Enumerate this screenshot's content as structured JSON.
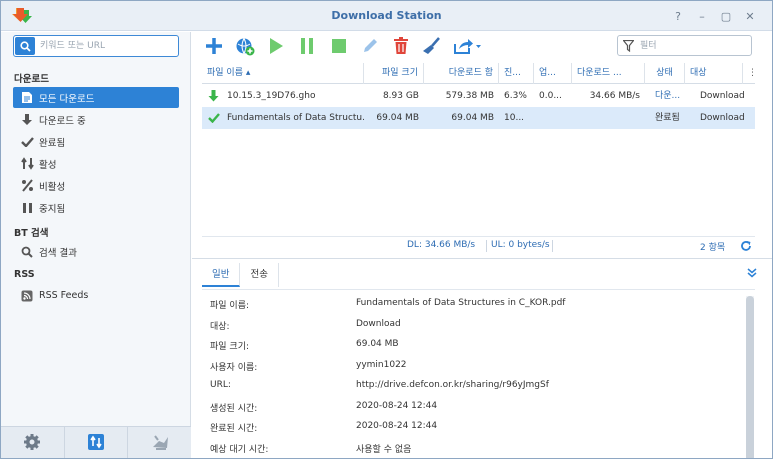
{
  "window": {
    "title": "Download Station",
    "controls": {
      "help": "?",
      "minimize": "–",
      "maximize": "▢",
      "close": "✕"
    }
  },
  "sidebar": {
    "search_placeholder": "키워드 또는 URL",
    "sections": {
      "download": "다운로드",
      "bt_search": "BT 검색",
      "rss": "RSS"
    },
    "items": [
      {
        "label": "모든 다운로드",
        "icon": "all-downloads-icon",
        "active": true
      },
      {
        "label": "다운로드 중",
        "icon": "downloading-icon"
      },
      {
        "label": "완료됨",
        "icon": "check-icon"
      },
      {
        "label": "활성",
        "icon": "active-arrows-icon"
      },
      {
        "label": "비활성",
        "icon": "percent-icon"
      },
      {
        "label": "중지됨",
        "icon": "pause-icon"
      },
      {
        "label": "검색 결과",
        "icon": "search-icon"
      },
      {
        "label": "RSS Feeds",
        "icon": "rss-icon"
      }
    ],
    "bottom_buttons": [
      "settings-icon",
      "transfer-icon",
      "emule-icon"
    ]
  },
  "toolbar": {
    "buttons": [
      "add-icon",
      "add-url-icon",
      "resume-icon",
      "pause-icon",
      "stop-icon",
      "edit-icon",
      "delete-icon",
      "clear-icon",
      "share-icon"
    ],
    "filter_placeholder": "필터"
  },
  "grid": {
    "columns": [
      "파일 이름 ▴",
      "파일 크기",
      "다운로드 함",
      "진...",
      "업...",
      "다운로드 ...",
      "상태",
      "대상",
      "⋮"
    ],
    "rows": [
      {
        "name": "10.15.3_19D76.gho",
        "size": "8.93 GB",
        "downloaded": "579.38 MB",
        "progress": "6.3%",
        "upload": "0.0...",
        "speed": "34.66 MB/s",
        "status": "다운...",
        "dest": "Download",
        "icon": "downloading-arrow-icon"
      },
      {
        "name": "Fundamentals of Data Structu...",
        "size": "69.04 MB",
        "downloaded": "69.04 MB",
        "progress": "10...",
        "upload": "",
        "speed": "",
        "status": "완료됨",
        "dest": "Download",
        "icon": "completed-check-icon"
      }
    ]
  },
  "statusbar": {
    "dl": "DL:  34.66 MB/s",
    "ul": "UL:  0 bytes/s",
    "count": "2 항목"
  },
  "details": {
    "tabs": [
      "일반",
      "전송"
    ],
    "rows": [
      {
        "label": "파일 이름:",
        "value": "Fundamentals of Data Structures in C_KOR.pdf"
      },
      {
        "label": "대상:",
        "value": "Download"
      },
      {
        "label": "파일 크기:",
        "value": "69.04 MB"
      },
      {
        "label": "사용자 이름:",
        "value": "yymin1022"
      },
      {
        "label": "URL:",
        "value": "http://drive.defcon.or.kr/sharing/r96yJmgSf"
      },
      {
        "label": "생성된 시간:",
        "value": "2020-08-24 12:44"
      },
      {
        "label": "완료된 시간:",
        "value": "2020-08-24 12:44"
      },
      {
        "label": "예상 대기 시간:",
        "value": "사용할 수 없음"
      }
    ]
  },
  "colors": {
    "accent": "#2d82d6",
    "link": "#2d6cb3",
    "green": "#3ab54a",
    "red": "#e0453a"
  }
}
